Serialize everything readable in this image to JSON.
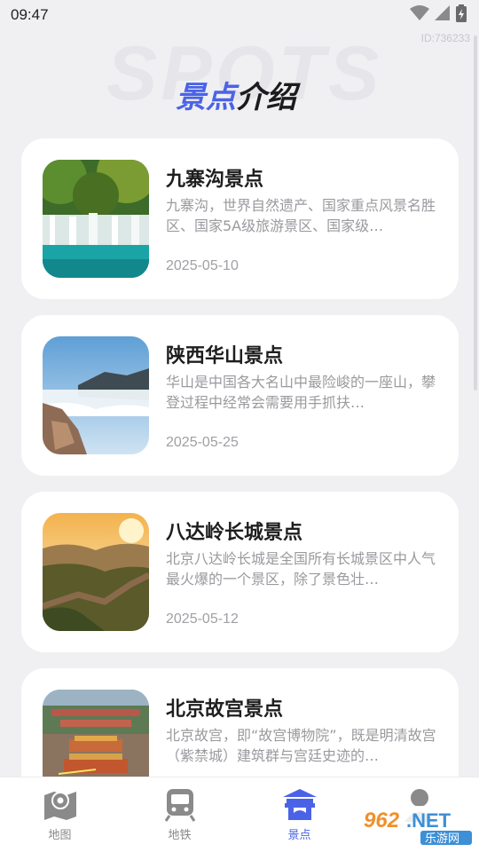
{
  "status": {
    "time": "09:47",
    "icons": [
      "wifi-icon",
      "signal-icon",
      "battery-icon"
    ]
  },
  "watermark_id": "ID:736233",
  "background_text": "SPOTS",
  "header": {
    "title_accent": "景点",
    "title_rest": "介绍"
  },
  "spots": [
    {
      "title": "九寨沟景点",
      "description": "九寨沟，世界自然遗产、国家重点风景名胜区、国家5A级旅游景区、国家级…",
      "date": "2025-05-10"
    },
    {
      "title": "陕西华山景点",
      "description": "华山是中国各大名山中最险峻的一座山，攀登过程中经常会需要用手抓扶…",
      "date": "2025-05-25"
    },
    {
      "title": "八达岭长城景点",
      "description": "北京八达岭长城是全国所有长城景区中人气最火爆的一个景区，除了景色壮…",
      "date": "2025-05-12"
    },
    {
      "title": "北京故宫景点",
      "description": "北京故宫，即“故宫博物院”，既是明清故宫（紫禁城）建筑群与宫廷史迹的…",
      "date": ""
    }
  ],
  "tabs": [
    {
      "label": "地图",
      "icon": "map-icon",
      "active": false
    },
    {
      "label": "地铁",
      "icon": "subway-icon",
      "active": false
    },
    {
      "label": "景点",
      "icon": "pavilion-icon",
      "active": true
    },
    {
      "label": "",
      "icon": "user-icon",
      "active": false
    }
  ],
  "overlay_logo": {
    "text_top": "962.NET",
    "text_bottom": "乐游网"
  },
  "colors": {
    "accent": "#4a63e6",
    "background": "#f0f0f3",
    "card": "#ffffff"
  }
}
